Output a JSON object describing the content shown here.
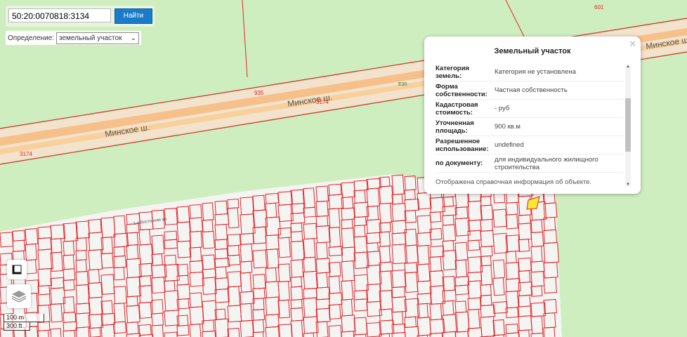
{
  "search": {
    "value": "50:20:0070818:3134",
    "button": "Найти"
  },
  "definition": {
    "label": "Определение:",
    "selected": "земельный участок"
  },
  "popup": {
    "title": "Земельный участок",
    "rows": [
      {
        "key": "Категория земель:",
        "value": "Категория не установлена"
      },
      {
        "key": "Форма собственности:",
        "value": "Частная собственность"
      },
      {
        "key": "Кадастровая стоимость:",
        "value": "- руб"
      },
      {
        "key": "Уточненная площадь:",
        "value": "900 кв.м"
      },
      {
        "key": "Разрешенное использование:",
        "value": "undefined"
      },
      {
        "key": "по документу:",
        "value": "для индивидуального жилищного строительства"
      }
    ],
    "note": "Отображена справочная информация об объекте."
  },
  "map_labels": {
    "road1": "Минское ш.",
    "road2": "Минское ш.",
    "road3": "Минское ш.",
    "e30": "E30",
    "n935": "935",
    "n3174a": "3174",
    "n3174b": "3174",
    "n601": "601",
    "street": "1-я Восточная ул."
  },
  "scale": {
    "metric": "100 m",
    "imperial": "300 ft"
  },
  "colors": {
    "parcel": "#e0262c",
    "map_bg": "#cfeec0",
    "button": "#1a7cc9"
  }
}
